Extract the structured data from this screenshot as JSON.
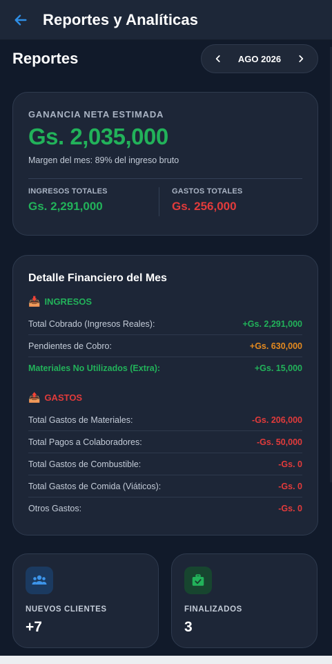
{
  "appbar": {
    "title": "Reportes y Analíticas",
    "back_icon": "arrow-left-icon"
  },
  "section": {
    "title": "Reportes",
    "month": "AGO 2026"
  },
  "profit": {
    "label": "GANANCIA NETA ESTIMADA",
    "amount": "Gs. 2,035,000",
    "margin_text": "Margen del mes: 89% del ingreso bruto",
    "income_label": "INGRESOS TOTALES",
    "income_value": "Gs. 2,291,000",
    "expense_label": "GASTOS TOTALES",
    "expense_value": "Gs. 256,000"
  },
  "detail": {
    "title": "Detalle Financiero del Mes",
    "income_title": "INGRESOS",
    "income_rows": [
      {
        "label": "Total Cobrado (Ingresos Reales):",
        "value": "+Gs. 2,291,000"
      },
      {
        "label": "Pendientes de Cobro:",
        "value": "+Gs. 630,000"
      },
      {
        "label": "Materiales No Utilizados (Extra):",
        "value": "+Gs. 15,000"
      }
    ],
    "expense_title": "GASTOS",
    "expense_rows": [
      {
        "label": "Total Gastos de Materiales:",
        "value": "-Gs. 206,000"
      },
      {
        "label": "Total Pagos a Colaboradores:",
        "value": "-Gs. 50,000"
      },
      {
        "label": "Total Gastos de Combustible:",
        "value": "-Gs. 0"
      },
      {
        "label": "Total Gastos de Comida (Viáticos):",
        "value": "-Gs. 0"
      },
      {
        "label": "Otros Gastos:",
        "value": "-Gs. 0"
      }
    ]
  },
  "stats": [
    {
      "label": "NUEVOS CLIENTES",
      "value": "+7",
      "icon": "users-icon"
    },
    {
      "label": "FINALIZADOS",
      "value": "3",
      "icon": "briefcase-check-icon"
    }
  ],
  "colors": {
    "income": "#22b25a",
    "expense": "#e23b3b",
    "pending": "#e58a1f",
    "accent": "#2f8fe6"
  }
}
